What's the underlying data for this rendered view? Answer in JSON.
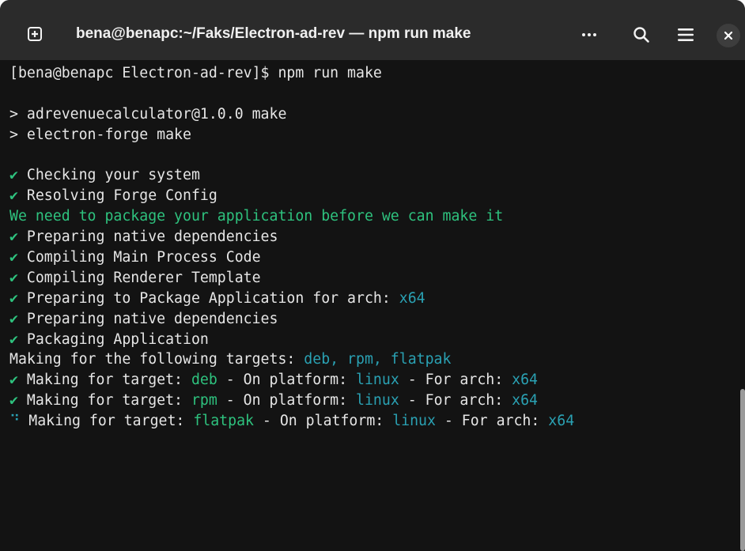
{
  "window": {
    "title": "bena@benapc:~/Faks/Electron-ad-rev — npm run make"
  },
  "titlebar_buttons": {
    "new_tab": "new-tab-icon",
    "menu": "more-icon",
    "search": "search-icon",
    "main_menu": "hamburger-icon",
    "close": "close-icon"
  },
  "colors": {
    "background": "#131313",
    "titlebar": "#2b2b2b",
    "text": "#e6e6e6",
    "green": "#2ec27e",
    "cyan": "#2aa1b3"
  },
  "terminal": {
    "lines": [
      [
        {
          "t": "[bena@benapc Electron-ad-rev]$ npm run make",
          "c": "default"
        }
      ],
      [],
      [
        {
          "t": "> adrevenuecalculator@1.0.0 make",
          "c": "default"
        }
      ],
      [
        {
          "t": "> electron-forge make",
          "c": "default"
        }
      ],
      [],
      [
        {
          "t": "✔",
          "c": "green"
        },
        {
          "t": " Checking your system",
          "c": "default"
        }
      ],
      [
        {
          "t": "✔",
          "c": "green"
        },
        {
          "t": " Resolving Forge Config",
          "c": "default"
        }
      ],
      [
        {
          "t": "We need to package your application before we can make it",
          "c": "green"
        }
      ],
      [
        {
          "t": "✔",
          "c": "green"
        },
        {
          "t": " Preparing native dependencies",
          "c": "default"
        }
      ],
      [
        {
          "t": "✔",
          "c": "green"
        },
        {
          "t": " Compiling Main Process Code",
          "c": "default"
        }
      ],
      [
        {
          "t": "✔",
          "c": "green"
        },
        {
          "t": " Compiling Renderer Template",
          "c": "default"
        }
      ],
      [
        {
          "t": "✔",
          "c": "green"
        },
        {
          "t": " Preparing to Package Application for arch: ",
          "c": "default"
        },
        {
          "t": "x64",
          "c": "cyan"
        }
      ],
      [
        {
          "t": "✔",
          "c": "green"
        },
        {
          "t": " Preparing native dependencies",
          "c": "default"
        }
      ],
      [
        {
          "t": "✔",
          "c": "green"
        },
        {
          "t": " Packaging Application",
          "c": "default"
        }
      ],
      [
        {
          "t": "Making for the following targets: ",
          "c": "default"
        },
        {
          "t": "deb, rpm, flatpak",
          "c": "cyan"
        }
      ],
      [
        {
          "t": "✔",
          "c": "green"
        },
        {
          "t": " Making for target: ",
          "c": "default"
        },
        {
          "t": "deb",
          "c": "green"
        },
        {
          "t": " - On platform: ",
          "c": "default"
        },
        {
          "t": "linux",
          "c": "cyan"
        },
        {
          "t": " - For arch: ",
          "c": "default"
        },
        {
          "t": "x64",
          "c": "cyan"
        }
      ],
      [
        {
          "t": "✔",
          "c": "green"
        },
        {
          "t": " Making for target: ",
          "c": "default"
        },
        {
          "t": "rpm",
          "c": "green"
        },
        {
          "t": " - On platform: ",
          "c": "default"
        },
        {
          "t": "linux",
          "c": "cyan"
        },
        {
          "t": " - For arch: ",
          "c": "default"
        },
        {
          "t": "x64",
          "c": "cyan"
        }
      ],
      [
        {
          "t": "⠙",
          "c": "cyan"
        },
        {
          "t": " Making for target: ",
          "c": "default"
        },
        {
          "t": "flatpak",
          "c": "green"
        },
        {
          "t": " - On platform: ",
          "c": "default"
        },
        {
          "t": "linux",
          "c": "cyan"
        },
        {
          "t": " - For arch: ",
          "c": "default"
        },
        {
          "t": "x64",
          "c": "cyan"
        }
      ]
    ]
  }
}
